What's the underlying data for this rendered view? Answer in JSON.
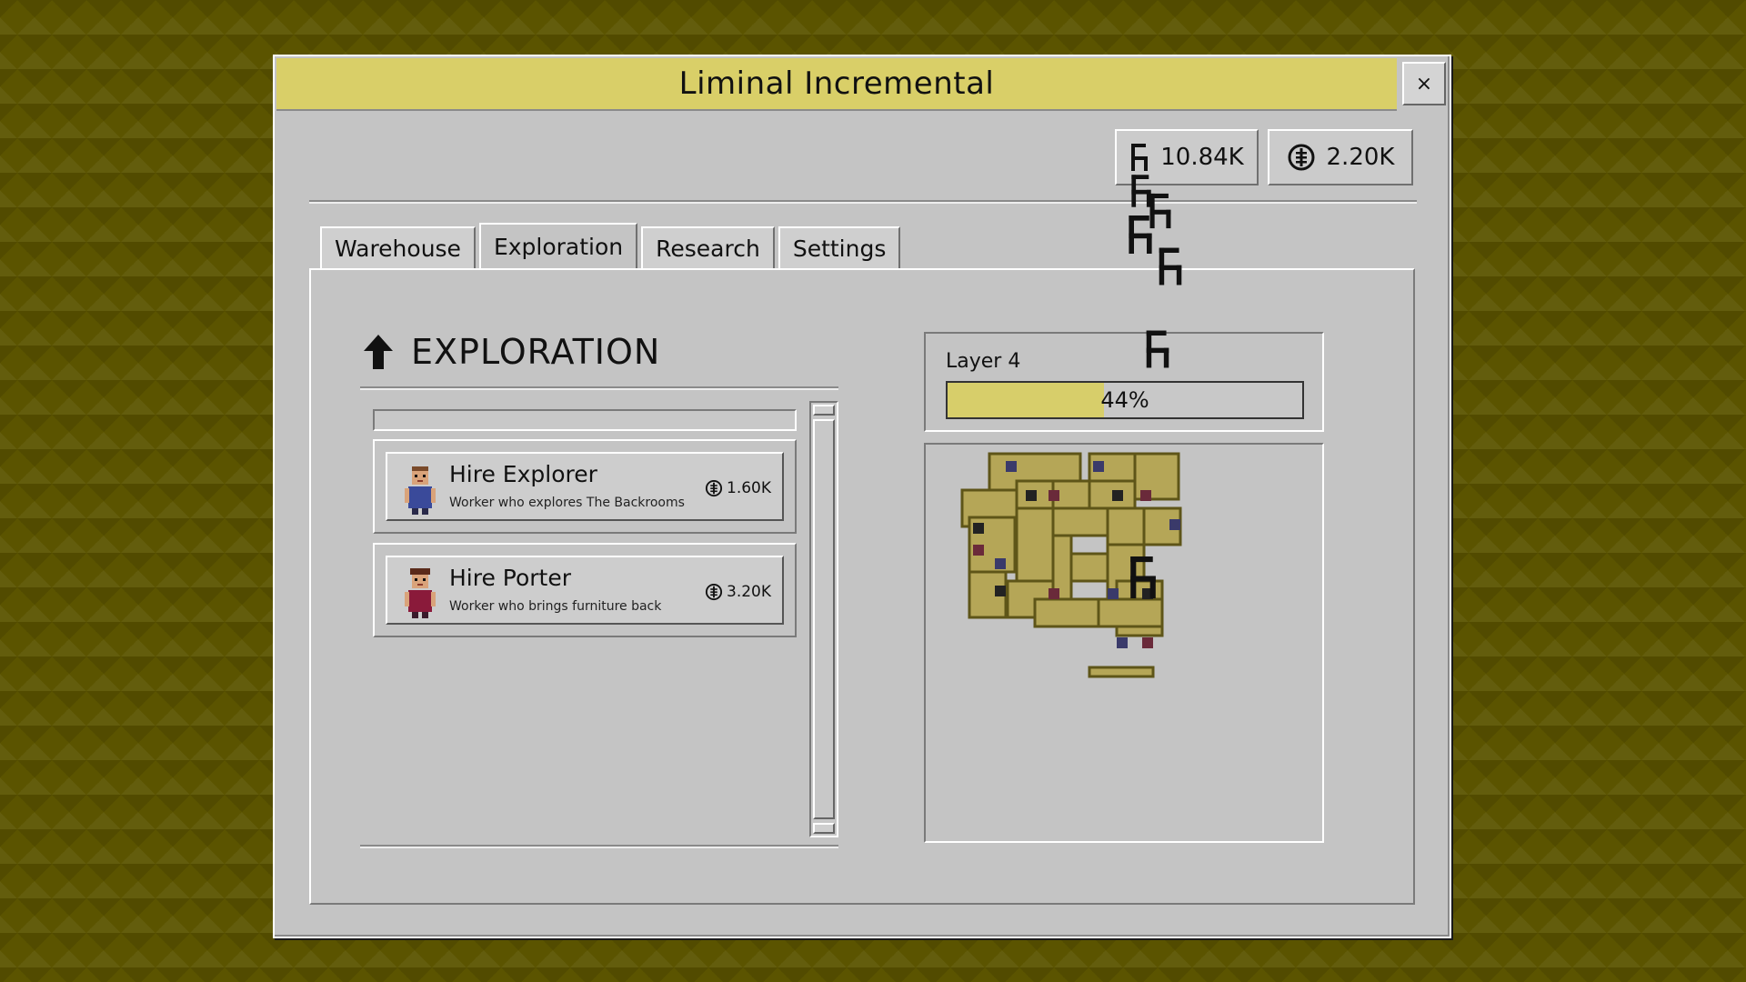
{
  "window": {
    "title": "Liminal Incremental",
    "close_label": "×"
  },
  "resources": {
    "chairs": {
      "value": "10.84K",
      "icon": "chair-icon"
    },
    "coins": {
      "value": "2.20K",
      "icon": "coin-icon"
    }
  },
  "tabs": [
    {
      "label": "Warehouse",
      "active": false
    },
    {
      "label": "Exploration",
      "active": true
    },
    {
      "label": "Research",
      "active": false
    },
    {
      "label": "Settings",
      "active": false
    }
  ],
  "exploration": {
    "title": "EXPLORATION",
    "icon": "arrow-up-icon",
    "hires": [
      {
        "title": "Hire Explorer",
        "description": "Worker who explores The Backrooms",
        "cost": "1.60K",
        "cost_icon": "coin-icon"
      },
      {
        "title": "Hire Porter",
        "description": "Worker who brings furniture back",
        "cost": "3.20K",
        "cost_icon": "coin-icon"
      }
    ]
  },
  "layer": {
    "label": "Layer 4",
    "progress_percent": 44,
    "progress_text": "44%"
  },
  "colors": {
    "background": "#5b5400",
    "accent_yellow": "#d9cf68",
    "panel_gray": "#c4c4c4",
    "map_tile": "#b5a657",
    "map_wall": "#5e5518"
  }
}
